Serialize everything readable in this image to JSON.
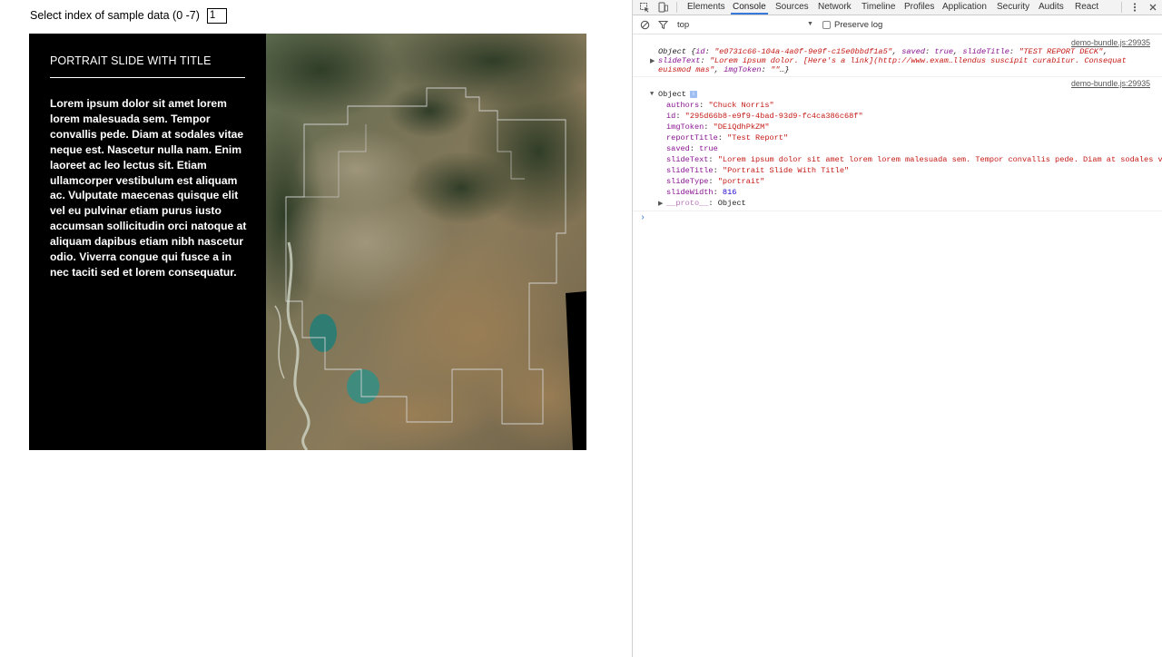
{
  "app": {
    "selector_label": "Select index of sample data (0 -7)",
    "selector_value": "1",
    "slide": {
      "title": "PORTRAIT SLIDE WITH TITLE",
      "body": "Lorem ipsum dolor sit amet lorem lorem malesuada sem. Tempor convallis pede. Diam at sodales vitae neque est. Nascetur nulla nam. Enim laoreet ac leo lectus sit. Etiam ullamcorper vestibulum est aliquam ac. Vulputate maecenas quisque elit vel eu pulvinar etiam purus iusto accumsan sollicitudin orci natoque at aliquam dapibus etiam nibh nascetur odio. Viverra congue qui fusce a in nec taciti sed et lorem consequatur."
    }
  },
  "devtools": {
    "tabs": [
      "Elements",
      "Console",
      "Sources",
      "Network",
      "Timeline",
      "Profiles",
      "Application",
      "Security",
      "Audits",
      "React"
    ],
    "active_tab": "Console",
    "context": "top",
    "preserve_log_label": "Preserve log",
    "messages": [
      {
        "source": "demo-bundle.js:29935",
        "line1_prefix": "Object {",
        "id_key": "id",
        "id_val": "\"e0731c66-104a-4a0f-9e9f-c15e0bbdf1a5\"",
        "saved_key": "saved",
        "saved_val": "true",
        "slideTitle_key": "slideTitle",
        "slideTitle_val": "\"TEST REPORT DECK\"",
        "slideText_key": "slideText",
        "slideText_val": "\"Lorem ipsum dolor. [Here's a link](http://www.exam…llendus suscipit curabitur. Consequat",
        "line3_text": "euismod mas\"",
        "imgToken_key": "imgToken",
        "imgToken_val": "\"\"",
        "ellipsis": "…}"
      },
      {
        "source": "demo-bundle.js:29935",
        "header": "Object",
        "props": [
          {
            "key": "authors",
            "value": "\"Chuck Norris\"",
            "kind": "s"
          },
          {
            "key": "id",
            "value": "\"295d66b8-e9f9-4bad-93d9-fc4ca386c68f\"",
            "kind": "s"
          },
          {
            "key": "imgToken",
            "value": "\"DEiQdhPkZM\"",
            "kind": "s"
          },
          {
            "key": "reportTitle",
            "value": "\"Test Report\"",
            "kind": "s"
          },
          {
            "key": "saved",
            "value": "true",
            "kind": "b"
          },
          {
            "key": "slideText",
            "value": "\"Lorem ipsum dolor sit amet lorem lorem malesuada sem. Tempor convallis pede. Diam at sodales vit",
            "kind": "s"
          },
          {
            "key": "slideTitle",
            "value": "\"Portrait Slide With Title\"",
            "kind": "s"
          },
          {
            "key": "slideType",
            "value": "\"portrait\"",
            "kind": "s"
          },
          {
            "key": "slideWidth",
            "value": "816",
            "kind": "n"
          }
        ],
        "proto_key": "__proto__",
        "proto_val": "Object"
      }
    ],
    "prompt_symbol": "›"
  },
  "colors": {
    "slide_bg": "#000000",
    "tab_active_underline": "#3879d9",
    "string": "#c41a16",
    "key": "#881391",
    "number": "#1c00cf"
  }
}
